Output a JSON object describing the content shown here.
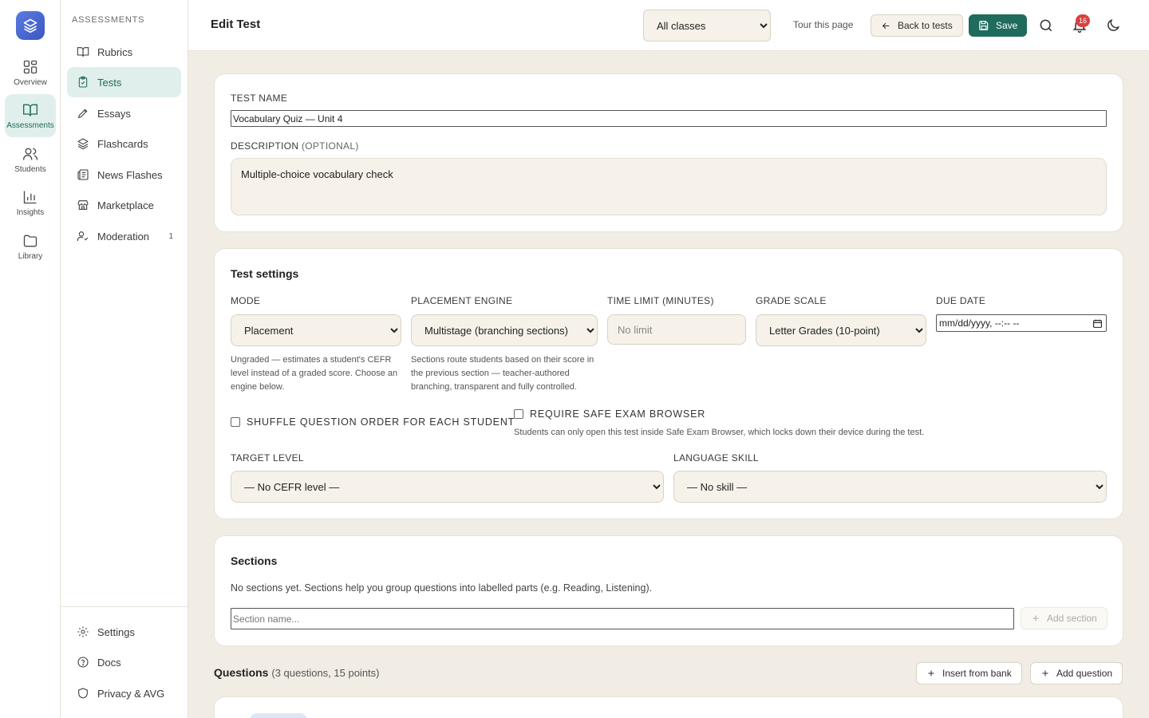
{
  "rail": {
    "items": [
      {
        "label": "Overview",
        "icon": "grid-icon"
      },
      {
        "label": "Assessments",
        "icon": "book-icon",
        "active": true
      },
      {
        "label": "Students",
        "icon": "users-icon"
      },
      {
        "label": "Insights",
        "icon": "bar-chart-icon"
      },
      {
        "label": "Library",
        "icon": "folder-icon"
      }
    ]
  },
  "sidebar": {
    "heading": "ASSESSMENTS",
    "items": [
      {
        "label": "Rubrics",
        "icon": "book-open-icon"
      },
      {
        "label": "Tests",
        "icon": "clipboard-check-icon",
        "active": true
      },
      {
        "label": "Essays",
        "icon": "pen-icon"
      },
      {
        "label": "Flashcards",
        "icon": "layers-icon"
      },
      {
        "label": "News Flashes",
        "icon": "newspaper-icon"
      },
      {
        "label": "Marketplace",
        "icon": "store-icon"
      },
      {
        "label": "Moderation",
        "icon": "user-check-icon",
        "badge": "1"
      }
    ],
    "footer": [
      {
        "label": "Settings",
        "icon": "gear-icon"
      },
      {
        "label": "Docs",
        "icon": "help-circle-icon"
      },
      {
        "label": "Privacy & AVG",
        "icon": "shield-icon"
      }
    ]
  },
  "header": {
    "title": "Edit Test",
    "class_select": "All classes",
    "tour": "Tour this page",
    "back": "Back to tests",
    "save": "Save",
    "notifications": "16"
  },
  "test": {
    "name_label": "TEST NAME",
    "name_value": "Vocabulary Quiz — Unit 4",
    "desc_label": "DESCRIPTION",
    "desc_optional": "(OPTIONAL)",
    "desc_value": "Multiple-choice vocabulary check"
  },
  "settings": {
    "title": "Test settings",
    "mode_label": "MODE",
    "mode_value": "Placement",
    "mode_hint": "Ungraded — estimates a student's CEFR level instead of a graded score. Choose an engine below.",
    "engine_label": "PLACEMENT ENGINE",
    "engine_value": "Multistage (branching sections)",
    "engine_hint": "Sections route students based on their score in the previous section — teacher-authored branching, transparent and fully controlled.",
    "time_label": "TIME LIMIT (MINUTES)",
    "time_placeholder": "No limit",
    "grade_label": "GRADE SCALE",
    "grade_value": "Letter Grades (10-point)",
    "due_label": "DUE DATE",
    "due_placeholder": "mm/dd/yyyy, --:-- --",
    "shuffle_label": "SHUFFLE QUESTION ORDER FOR EACH STUDENT",
    "seb_label": "REQUIRE SAFE EXAM BROWSER",
    "seb_hint": "Students can only open this test inside Safe Exam Browser, which locks down their device during the test.",
    "target_label": "TARGET LEVEL",
    "target_value": "— No CEFR level —",
    "skill_label": "LANGUAGE SKILL",
    "skill_value": "— No skill —"
  },
  "sections": {
    "title": "Sections",
    "empty": "No sections yet. Sections help you group questions into labelled parts (e.g. Reading, Listening).",
    "placeholder": "Section name...",
    "add": "Add section"
  },
  "questions": {
    "title": "Questions",
    "meta": "(3 questions, 15 points)",
    "insert": "Insert from bank",
    "add": "Add question"
  },
  "colors": {
    "accent": "#1f6b5c",
    "accent_soft": "#e0efec",
    "background": "#f2ede4",
    "badge": "#d94040"
  }
}
